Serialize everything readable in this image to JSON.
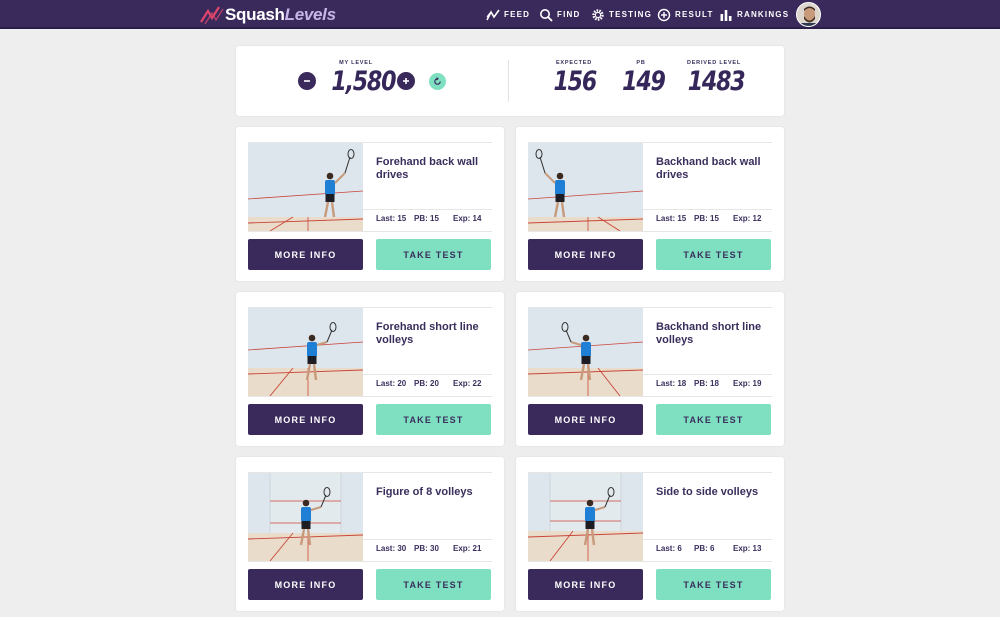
{
  "app": {
    "logo_main": "Squash",
    "logo_accent": "Levels"
  },
  "nav": {
    "items": [
      {
        "label": "FEED",
        "icon": "trend-icon"
      },
      {
        "label": "FIND",
        "icon": "search-icon"
      },
      {
        "label": "TESTING",
        "icon": "gear-icon"
      },
      {
        "label": "RESULT",
        "icon": "plus-circle-icon"
      },
      {
        "label": "RANKINGS",
        "icon": "bar-chart-icon"
      }
    ]
  },
  "stats": {
    "my_level_label": "MY LEVEL",
    "my_level_value": "1,580",
    "expected_label": "EXPECTED",
    "expected_value": "156",
    "pb_label": "PB",
    "pb_value": "149",
    "derived_label": "DERIVED LEVEL",
    "derived_value": "1483"
  },
  "colors": {
    "brand": "#3a2a5c",
    "accent": "#7fe0c1",
    "logo_mark": "#e0456e",
    "background": "#eeeeee"
  },
  "buttons": {
    "more_info": "MORE INFO",
    "take_test": "TAKE TEST"
  },
  "drills": [
    {
      "title": "Forehand back wall drives",
      "last": "Last: 15",
      "pb": "PB: 15",
      "exp": "Exp: 14"
    },
    {
      "title": "Backhand back wall drives",
      "last": "Last: 15",
      "pb": "PB: 15",
      "exp": "Exp: 12"
    },
    {
      "title": "Forehand short line volleys",
      "last": "Last: 20",
      "pb": "PB: 20",
      "exp": "Exp: 22"
    },
    {
      "title": "Backhand short line volleys",
      "last": "Last: 18",
      "pb": "PB: 18",
      "exp": "Exp: 19"
    },
    {
      "title": "Figure of 8 volleys",
      "last": "Last: 30",
      "pb": "PB: 30",
      "exp": "Exp: 21"
    },
    {
      "title": "Side to side volleys",
      "last": "Last: 6",
      "pb": "PB: 6",
      "exp": "Exp: 13"
    }
  ]
}
